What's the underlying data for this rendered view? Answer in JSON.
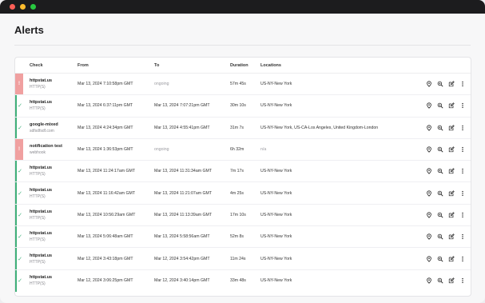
{
  "window": {
    "colors": {
      "close": "#ff5f57",
      "minimize": "#febc2e",
      "zoom": "#28c840"
    }
  },
  "page": {
    "title": "Alerts"
  },
  "table": {
    "headers": {
      "check": "Check",
      "from": "From",
      "to": "To",
      "duration": "Duration",
      "locations": "Locations"
    },
    "rows": [
      {
        "status": "down",
        "name": "httpstat.us",
        "type": "HTTP(S)",
        "from": "Mar 13, 2024 7:10:58pm GMT",
        "to": "ongoing",
        "duration": "57m 45s",
        "locations": "US-NY-New York"
      },
      {
        "status": "up",
        "name": "httpstat.us",
        "type": "HTTP(S)",
        "from": "Mar 13, 2024 6:37:11pm GMT",
        "to": "Mar 13, 2024 7:07:21pm GMT",
        "duration": "30m 10s",
        "locations": "US-NY-New York"
      },
      {
        "status": "up",
        "name": "google-mixed",
        "type": "sdfsdfsdf.com",
        "from": "Mar 13, 2024 4:24:34pm GMT",
        "to": "Mar 13, 2024 4:55:41pm GMT",
        "duration": "31m 7s",
        "locations": "US-NY-New York, US-CA-Los Angeles, United Kingdom-London"
      },
      {
        "status": "down",
        "name": "notification test",
        "type": "webhook",
        "from": "Mar 13, 2024 1:36:53pm GMT",
        "to": "ongoing",
        "duration": "6h 32m",
        "locations": "n/a"
      },
      {
        "status": "up",
        "name": "httpstat.us",
        "type": "HTTP(S)",
        "from": "Mar 13, 2024 11:24:17am GMT",
        "to": "Mar 13, 2024 11:31:34am GMT",
        "duration": "7m 17s",
        "locations": "US-NY-New York"
      },
      {
        "status": "up",
        "name": "httpstat.us",
        "type": "HTTP(S)",
        "from": "Mar 13, 2024 11:16:42am GMT",
        "to": "Mar 13, 2024 11:21:07am GMT",
        "duration": "4m 25s",
        "locations": "US-NY-New York"
      },
      {
        "status": "up",
        "name": "httpstat.us",
        "type": "HTTP(S)",
        "from": "Mar 13, 2024 10:56:29am GMT",
        "to": "Mar 13, 2024 11:13:39am GMT",
        "duration": "17m 10s",
        "locations": "US-NY-New York"
      },
      {
        "status": "up",
        "name": "httpstat.us",
        "type": "HTTP(S)",
        "from": "Mar 13, 2024 5:06:48am GMT",
        "to": "Mar 13, 2024 5:58:56am GMT",
        "duration": "52m 8s",
        "locations": "US-NY-New York"
      },
      {
        "status": "up",
        "name": "httpstat.us",
        "type": "HTTP(S)",
        "from": "Mar 12, 2024 3:43:18pm GMT",
        "to": "Mar 12, 2024 3:54:42pm GMT",
        "duration": "11m 24s",
        "locations": "US-NY-New York"
      },
      {
        "status": "up",
        "name": "httpstat.us",
        "type": "HTTP(S)",
        "from": "Mar 12, 2024 3:06:25pm GMT",
        "to": "Mar 12, 2024 3:40:14pm GMT",
        "duration": "33m 48s",
        "locations": "US-NY-New York"
      }
    ],
    "row_actions": [
      "pin-icon",
      "inspect-icon",
      "edit-icon",
      "more-icon"
    ],
    "colors": {
      "down": "#f0a0a0",
      "up": "#3fb07a"
    }
  }
}
